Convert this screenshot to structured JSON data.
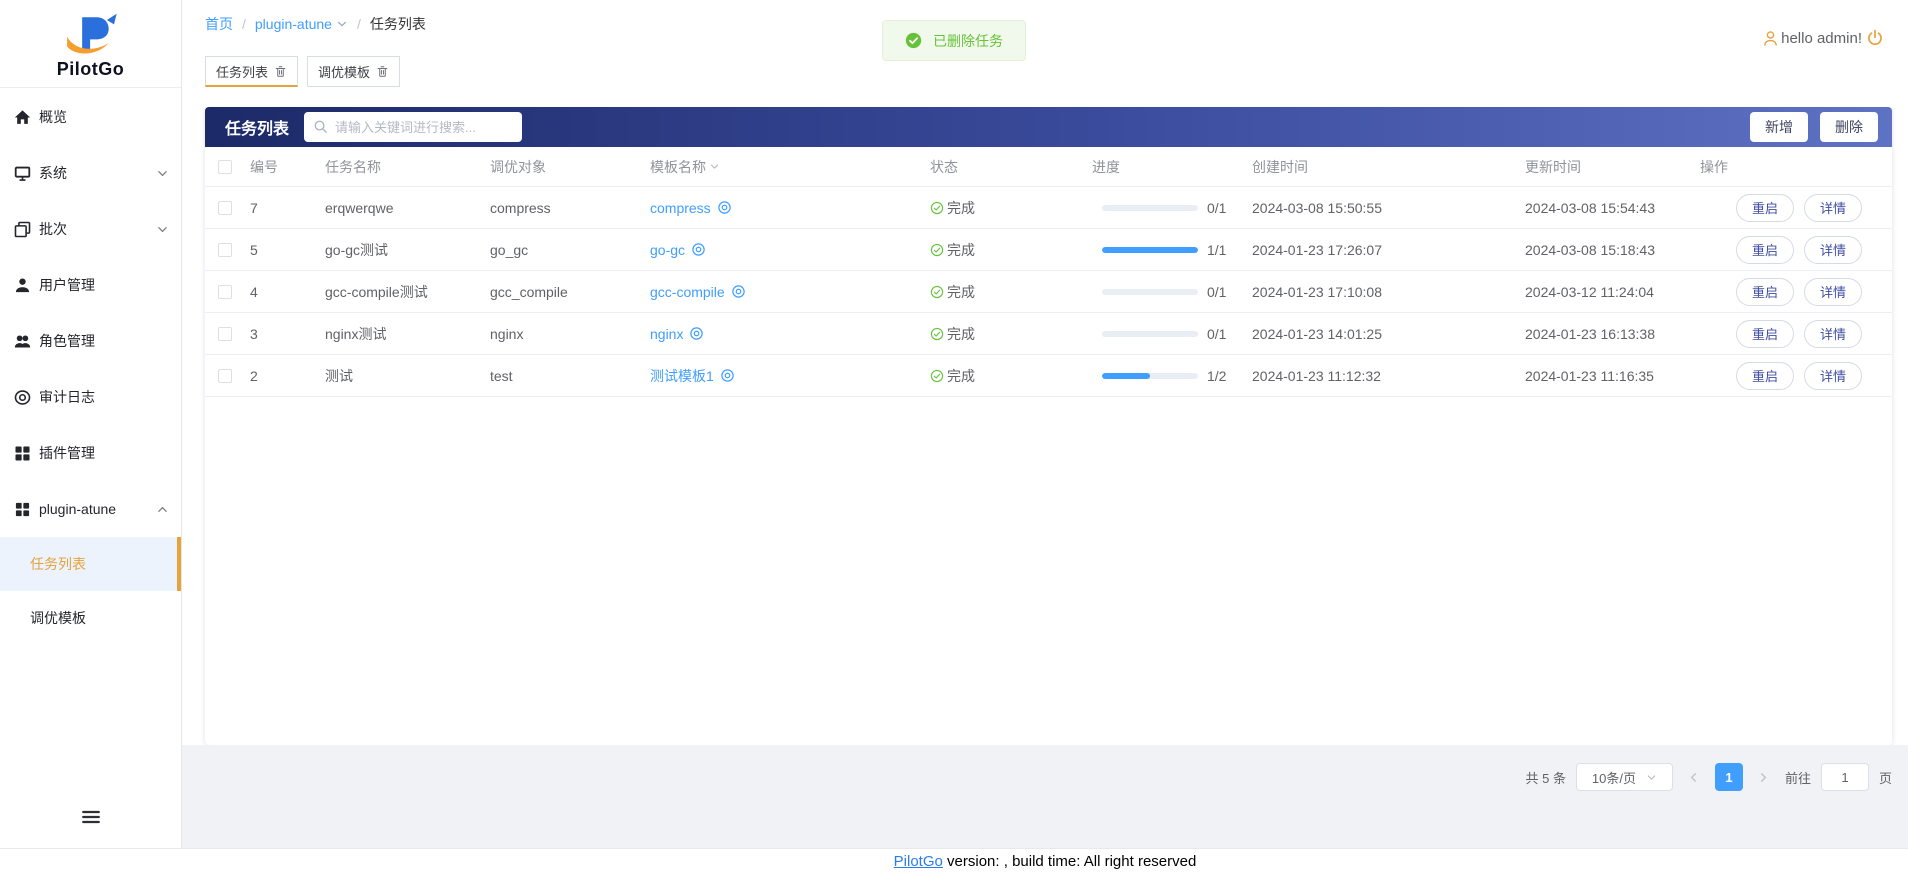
{
  "sidebar": {
    "logo_text": "PilotGo",
    "items": [
      {
        "id": "overview",
        "label": "概览",
        "icon": "home-icon"
      },
      {
        "id": "system",
        "label": "系统",
        "icon": "monitor-icon",
        "chevron": "down"
      },
      {
        "id": "batch",
        "label": "批次",
        "icon": "batch-icon",
        "chevron": "down"
      },
      {
        "id": "user-management",
        "label": "用户管理",
        "icon": "user-icon"
      },
      {
        "id": "role-management",
        "label": "角色管理",
        "icon": "role-icon"
      },
      {
        "id": "audit-log",
        "label": "审计日志",
        "icon": "audit-icon"
      },
      {
        "id": "plugin-management",
        "label": "插件管理",
        "icon": "plugin-icon"
      },
      {
        "id": "plugin-atune",
        "label": "plugin-atune",
        "icon": "grid-icon",
        "chevron": "up",
        "children": [
          {
            "id": "task-list",
            "label": "任务列表",
            "active": true
          },
          {
            "id": "tuning-template",
            "label": "调优模板",
            "active": false
          }
        ]
      }
    ]
  },
  "header": {
    "breadcrumb": [
      {
        "label": "首页",
        "link": true,
        "dropdown": false
      },
      {
        "label": "plugin-atune",
        "link": true,
        "dropdown": true
      },
      {
        "label": "任务列表",
        "link": false,
        "dropdown": false
      }
    ],
    "greeting": "hello admin!"
  },
  "toast": {
    "message": "已删除任务"
  },
  "tabs": [
    {
      "label": "任务列表",
      "active": true
    },
    {
      "label": "调优模板",
      "active": false
    }
  ],
  "panel": {
    "title": "任务列表",
    "search_placeholder": "请输入关键词进行搜索...",
    "add_label": "新增",
    "delete_label": "删除"
  },
  "table": {
    "headers": [
      "编号",
      "任务名称",
      "调优对象",
      "模板名称",
      "状态",
      "进度",
      "创建时间",
      "更新时间",
      "操作"
    ],
    "sortable_header": "模板名称",
    "row_actions": [
      "重启",
      "详情"
    ],
    "rows": [
      {
        "id": "7",
        "name": "erqwerqwe",
        "target": "compress",
        "template": "compress",
        "status": "完成",
        "progress": {
          "percent": 0,
          "label": "0/1"
        },
        "created": "2024-03-08 15:50:55",
        "updated": "2024-03-08 15:54:43"
      },
      {
        "id": "5",
        "name": "go-gc测试",
        "target": "go_gc",
        "template": "go-gc",
        "status": "完成",
        "progress": {
          "percent": 100,
          "label": "1/1"
        },
        "created": "2024-01-23 17:26:07",
        "updated": "2024-03-08 15:18:43"
      },
      {
        "id": "4",
        "name": "gcc-compile测试",
        "target": "gcc_compile",
        "template": "gcc-compile",
        "status": "完成",
        "progress": {
          "percent": 0,
          "label": "0/1"
        },
        "created": "2024-01-23 17:10:08",
        "updated": "2024-03-12 11:24:04"
      },
      {
        "id": "3",
        "name": "nginx测试",
        "target": "nginx",
        "template": "nginx",
        "status": "完成",
        "progress": {
          "percent": 0,
          "label": "0/1"
        },
        "created": "2024-01-23 14:01:25",
        "updated": "2024-01-23 16:13:38"
      },
      {
        "id": "2",
        "name": "测试",
        "target": "test",
        "template": "测试模板1",
        "status": "完成",
        "progress": {
          "percent": 50,
          "label": "1/2"
        },
        "created": "2024-01-23 11:12:32",
        "updated": "2024-01-23 11:16:35"
      }
    ]
  },
  "pagination": {
    "total": "共 5 条",
    "page_size": "10条/页",
    "current_page": "1",
    "goto_label": "前往",
    "goto_value": "1",
    "page_unit": "页"
  },
  "footer": {
    "link_text": "PilotGo",
    "rest_text": " version: , build time: All right reserved"
  },
  "colors": {
    "primary": "#409eff",
    "success": "#67c23a",
    "accent_orange": "#e6a23c",
    "bar_gradient_start": "#1c2a68",
    "bar_gradient_end": "#5e72c4"
  }
}
